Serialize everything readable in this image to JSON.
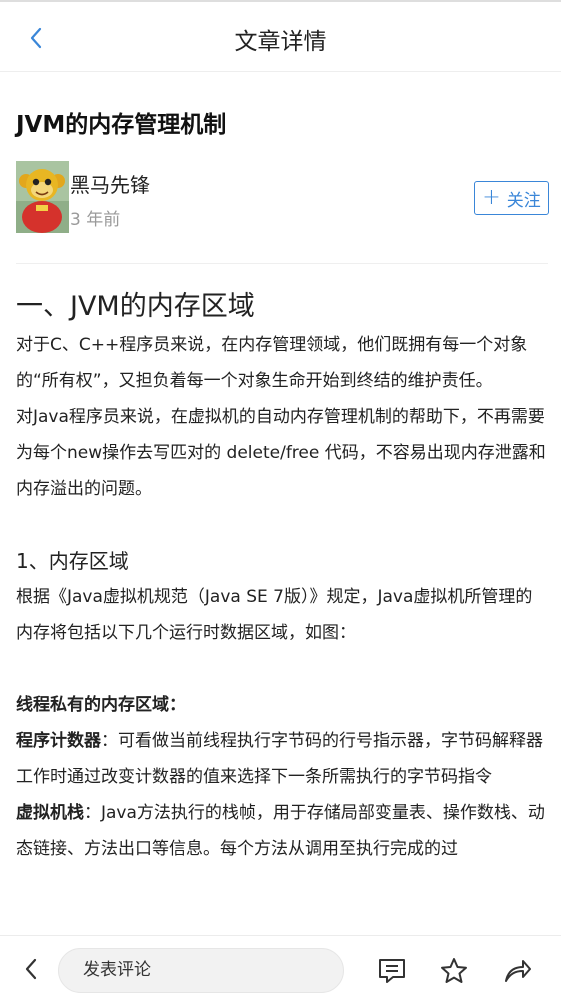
{
  "header": {
    "title": "文章详情"
  },
  "article": {
    "title": "JVM的内存管理机制",
    "author_name": "黑马先锋",
    "time": "3 年前",
    "follow_label": "关注",
    "heading_1": "一、JVM的内存区域",
    "para_1": "对于C、C++程序员来说，在内存管理领域，他们既拥有每一个对象的“所有权”，又担负着每一个对象生命开始到终结的维护责任。",
    "para_2": "对Java程序员来说，在虚拟机的自动内存管理机制的帮助下，不再需要为每个new操作去写匹对的 delete/free 代码，不容易出现内存泄露和内存溢出的问题。",
    "heading_2": "1、内存区域",
    "para_3": "根据《Java虚拟机规范（Java SE 7版）》规定，Java虚拟机所管理的内存将包括以下几个运行时数据区域，如图：",
    "thread_private_heading": "线程私有的内存区域：",
    "pc_term": "程序计数器",
    "pc_desc": "：可看做当前线程执行字节码的行号指示器，字节码解释器工作时通过改变计数器的值来选择下一条所需执行的字节码指令",
    "vm_stack_term": "虚拟机栈",
    "vm_stack_desc": "：Java方法执行的栈帧，用于存储局部变量表、操作数栈、动态链接、方法出口等信息。每个方法从调用至执行完成的过"
  },
  "bottom_bar": {
    "comment_placeholder": "发表评论"
  },
  "icons": {
    "back": "chevron-left-icon",
    "plus": "plus-icon",
    "comment": "comment-icon",
    "star": "star-icon",
    "share": "share-icon"
  },
  "colors": {
    "accent": "#3a86d8",
    "muted_text": "#9a9a9a"
  }
}
